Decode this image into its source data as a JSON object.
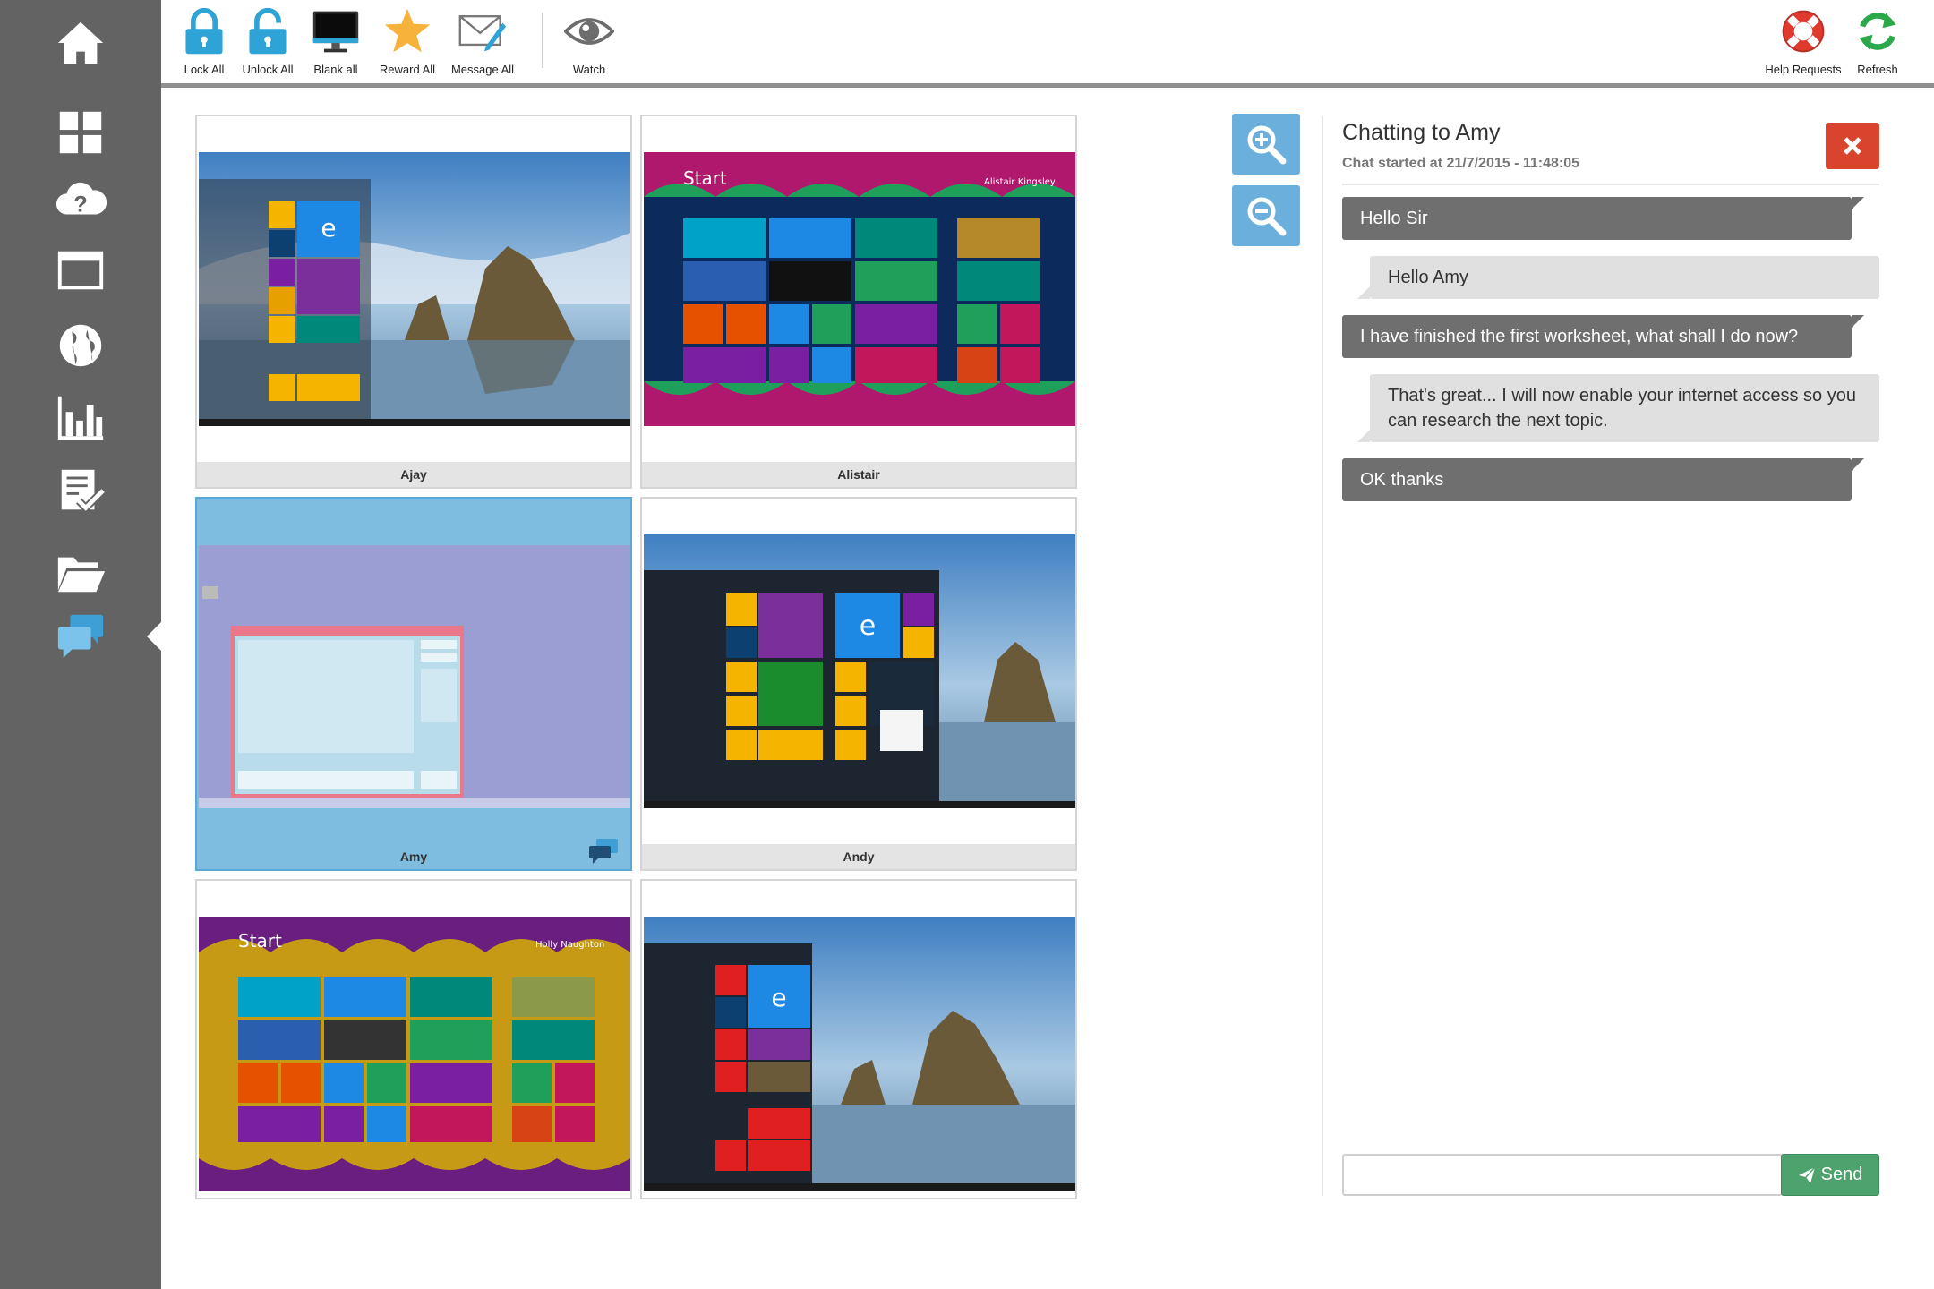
{
  "toolbar": {
    "lock_all": "Lock All",
    "unlock_all": "Unlock All",
    "blank_all": "Blank all",
    "reward_all": "Reward All",
    "message_all": "Message All",
    "watch": "Watch",
    "help_requests": "Help Requests",
    "refresh": "Refresh"
  },
  "sidebar": {
    "items": [
      "home-icon",
      "grid-icon",
      "help-cloud-icon",
      "window-icon",
      "globe-icon",
      "bar-chart-icon",
      "checklist-icon",
      "folder-icon",
      "chat-icon"
    ],
    "active": "chat-icon"
  },
  "students": [
    {
      "name": "Ajay",
      "screen": "win10",
      "selected": false
    },
    {
      "name": "Alistair",
      "screen": "win8-pink",
      "user": "Alistair Kingsley",
      "start": "Start",
      "selected": false
    },
    {
      "name": "Amy",
      "screen": "classroom-chat",
      "selected": true,
      "chat_badge": true
    },
    {
      "name": "Andy",
      "screen": "win10-tiles",
      "selected": false
    },
    {
      "name": "",
      "screen": "win8-yellow",
      "user": "Holly Naughton",
      "start": "Start",
      "selected": false
    },
    {
      "name": "",
      "screen": "win10-red",
      "selected": false
    }
  ],
  "chat": {
    "title": "Chatting to Amy",
    "started": "Chat started at 21/7/2015 - 11:48:05",
    "messages": [
      {
        "from": "student",
        "text": "Hello Sir"
      },
      {
        "from": "teacher",
        "text": "Hello Amy"
      },
      {
        "from": "student",
        "text": "I have finished the first worksheet, what shall I do now?"
      },
      {
        "from": "teacher",
        "text": "That's great... I will now enable your internet access so you can research the next topic."
      },
      {
        "from": "student",
        "text": "OK thanks"
      }
    ],
    "input_value": "",
    "send_label": "Send"
  },
  "colors": {
    "sidebar": "#636363",
    "accent_blue": "#6bb0dd",
    "lock_blue": "#2ea3d6",
    "close_red": "#d9442f",
    "send_green": "#4ea26e",
    "help_red": "#e03a2f",
    "refresh_green": "#2aa84a"
  }
}
